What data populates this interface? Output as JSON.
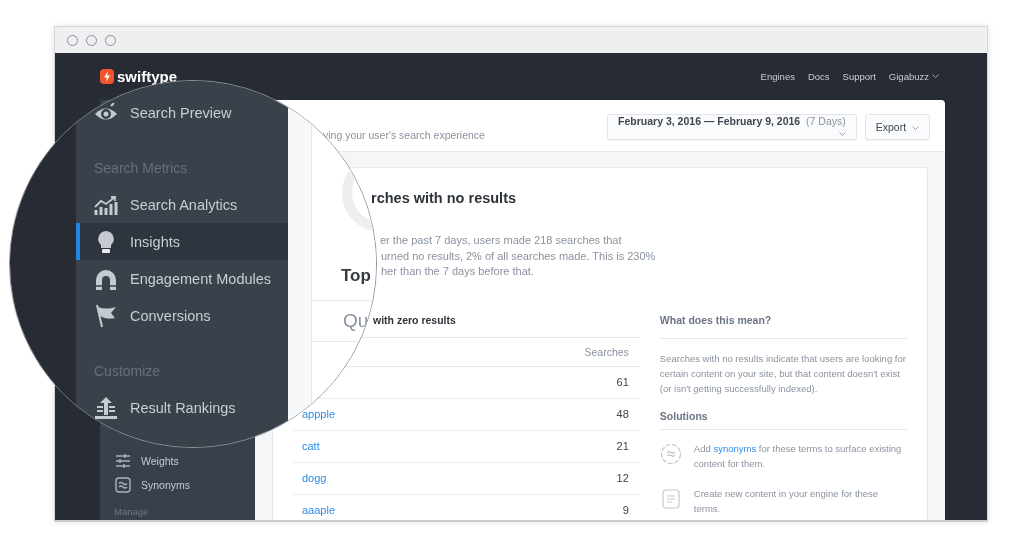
{
  "header": {
    "logo": "swiftype",
    "nav": [
      "Engines",
      "Docs",
      "Support"
    ],
    "account": "Gigabuzz"
  },
  "lens": {
    "entries": [
      {
        "kind": "item",
        "label": "Search Preview",
        "selected": false
      },
      {
        "kind": "header",
        "label": "Search Metrics"
      },
      {
        "kind": "item",
        "label": "Search Analytics",
        "selected": false
      },
      {
        "kind": "item",
        "label": "Insights",
        "selected": true
      },
      {
        "kind": "item",
        "label": "Engagement Modules",
        "selected": false
      },
      {
        "kind": "item",
        "label": "Conversions",
        "selected": false
      },
      {
        "kind": "header",
        "label": "Customize"
      },
      {
        "kind": "item",
        "label": "Result Rankings",
        "selected": false
      }
    ],
    "card": {
      "title_part": "Top",
      "subtitle_part": "Qu"
    }
  },
  "sidebar": {
    "items": [
      {
        "label": "Weights"
      },
      {
        "label": "Synonyms"
      }
    ],
    "section": "Manage"
  },
  "main": {
    "subtitle": "ying your user's search experience",
    "date_range": "February 3, 2016 — February 9, 2016",
    "date_days": "(7 Days)",
    "export": "Export"
  },
  "card": {
    "title": "rches with no results",
    "description_lines": [
      "er the past 7 days, users made 218 searches that",
      "urned no results, 2% of all searches made. This is 230%",
      "her than the 7 days before that."
    ],
    "table": {
      "title": "with zero results",
      "columns": [
        "Searches"
      ],
      "rows": [
        {
          "count": "61"
        },
        {
          "term": "appple",
          "count": "48"
        },
        {
          "term": "catt",
          "count": "21"
        },
        {
          "term": "dogg",
          "count": "12"
        },
        {
          "term": "aaaple",
          "count": "9"
        }
      ]
    }
  },
  "info": {
    "heading": "What does this mean?",
    "text": "Searches with no results indicate that users are looking for certain content on your site, but that content doesn't exist (or isn't getting successfully indexed).",
    "solutions_heading": "Solutions",
    "solutions": [
      {
        "kind": "synonym",
        "before": "Add ",
        "link": "synonyms",
        "after": " for these terms to surface existing content for them."
      },
      {
        "kind": "content",
        "before": "Create new content in your engine for these terms."
      }
    ]
  }
}
